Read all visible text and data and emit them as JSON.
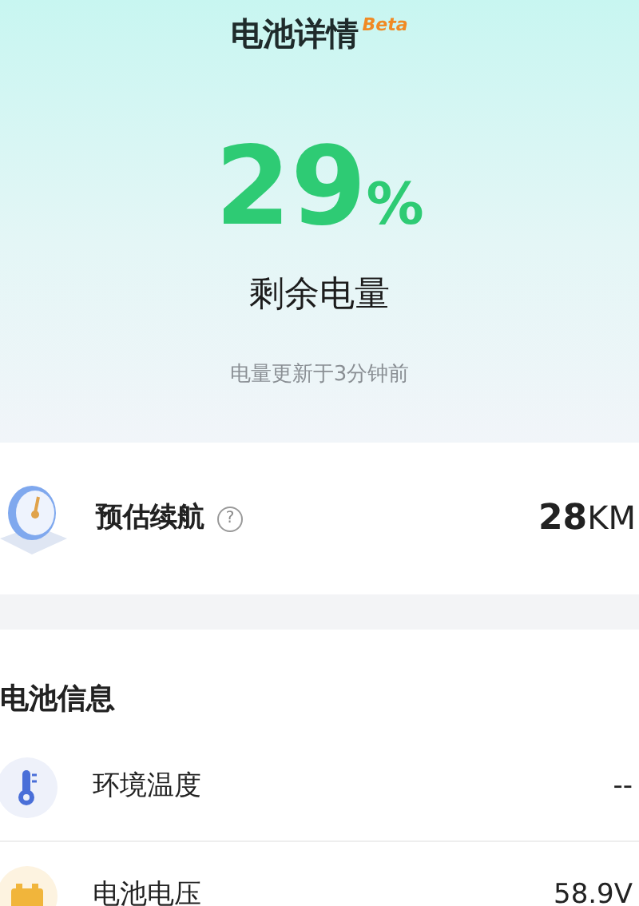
{
  "header": {
    "title": "电池详情",
    "badge": "Beta"
  },
  "battery": {
    "percent": "29",
    "unit": "%",
    "label": "剩余电量",
    "updated": "电量更新于3分钟前"
  },
  "range": {
    "label": "预估续航",
    "help": "?",
    "value": "28",
    "unit": "KM"
  },
  "info": {
    "title": "电池信息",
    "rows": [
      {
        "kind": "temperature",
        "label": "环境温度",
        "value": "--"
      },
      {
        "kind": "voltage",
        "label": "电池电压",
        "value": "58.9V"
      }
    ]
  }
}
